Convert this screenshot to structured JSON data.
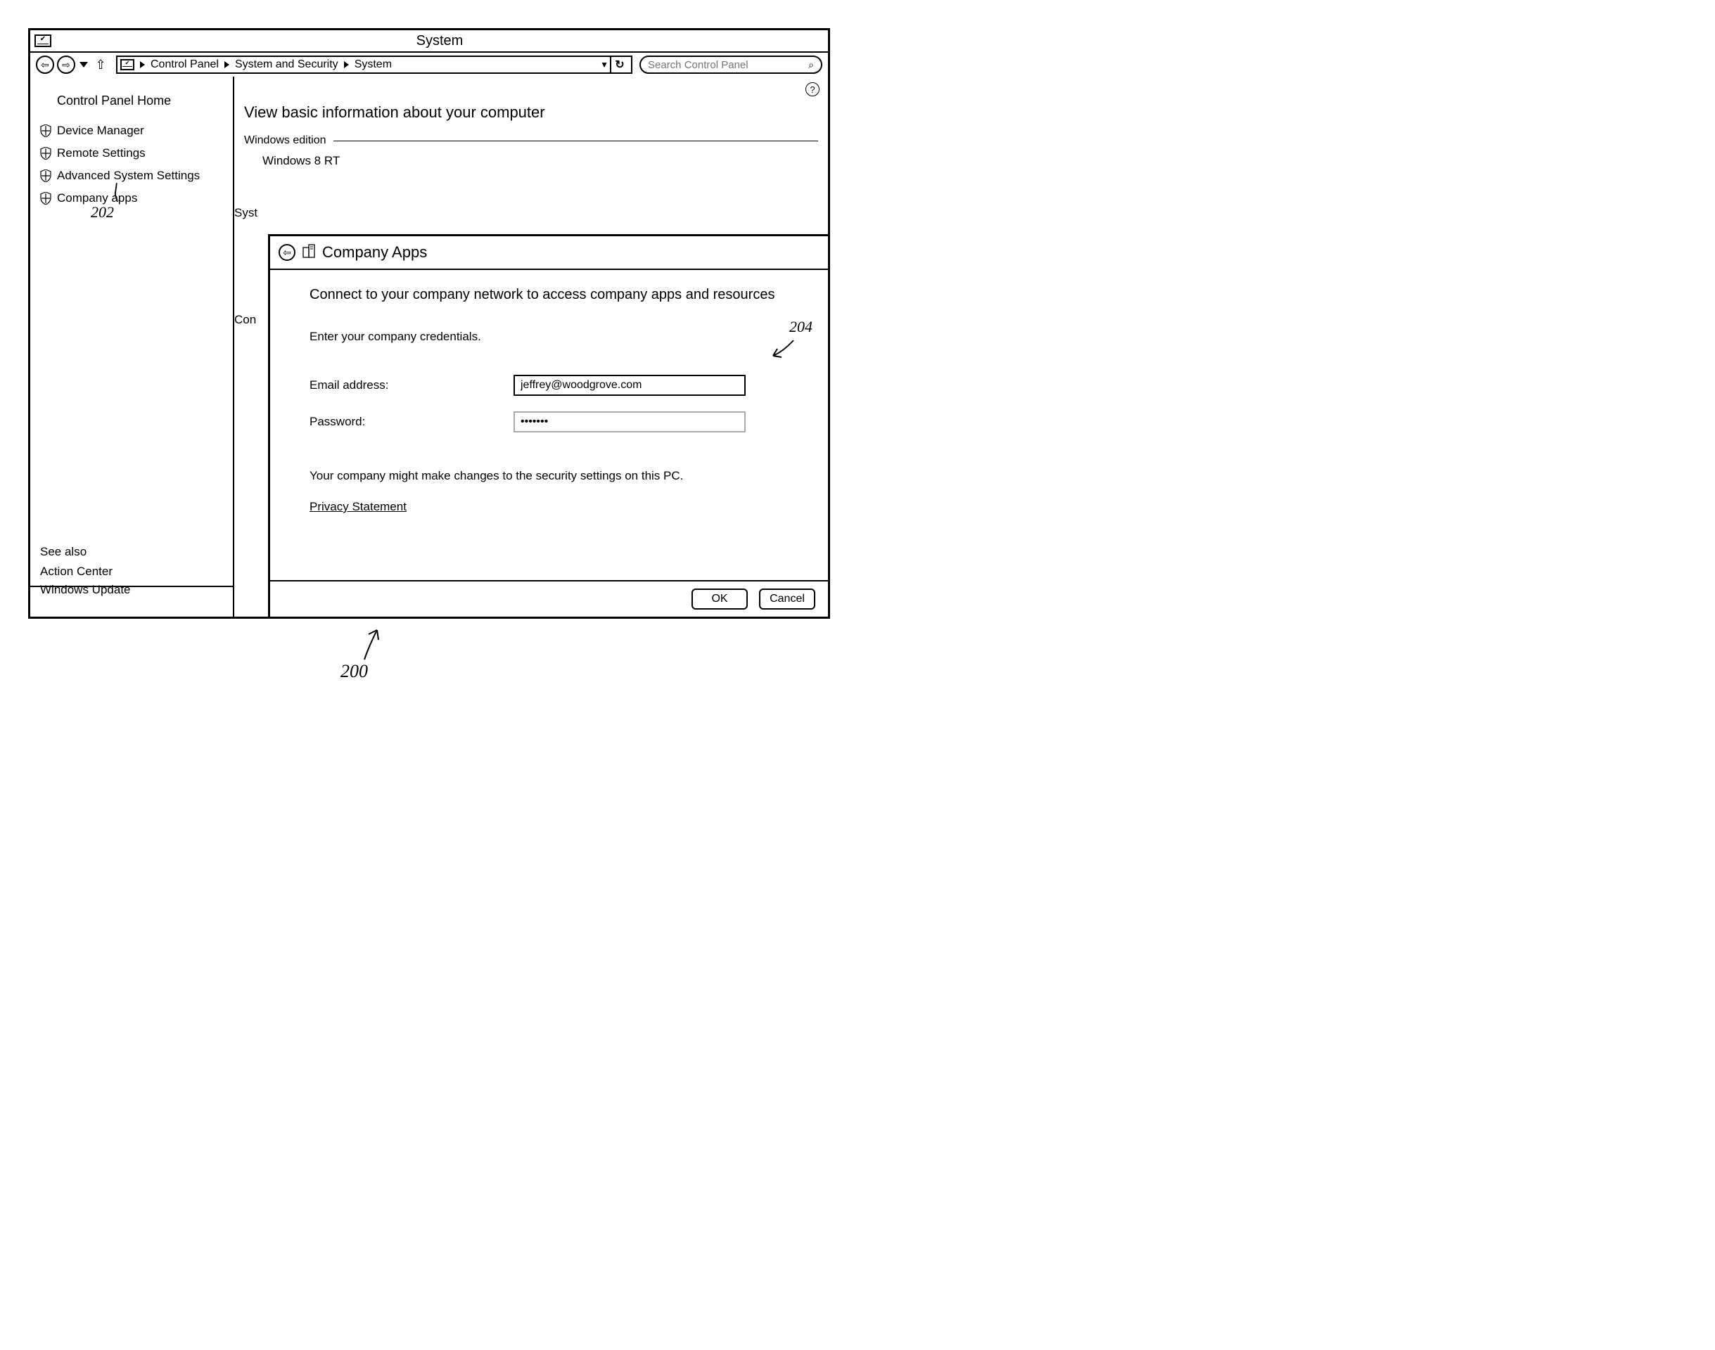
{
  "window": {
    "title": "System"
  },
  "toolbar": {
    "breadcrumb": [
      "Control Panel",
      "System and Security",
      "System"
    ],
    "search_placeholder": "Search Control Panel"
  },
  "sidebar": {
    "home": "Control Panel Home",
    "items": [
      {
        "label": "Device Manager"
      },
      {
        "label": "Remote Settings"
      },
      {
        "label": "Advanced System Settings"
      },
      {
        "label": "Company apps"
      }
    ],
    "see_also_title": "See also",
    "see_also": [
      {
        "label": "Action Center"
      },
      {
        "label": "Windows Update"
      }
    ]
  },
  "main": {
    "title": "View basic information about your computer",
    "section_windows_edition": "Windows edition",
    "edition": "Windows 8 RT",
    "partial_syst": "Syst",
    "partial_con": "Con"
  },
  "dialog": {
    "title": "Company Apps",
    "headline": "Connect to your company network to access company apps and resources",
    "sub": "Enter your company credentials.",
    "email_label": "Email address:",
    "email_value": "jeffrey@woodgrove.com",
    "password_label": "Password:",
    "password_value": "•••••••",
    "notice": "Your company might make changes to the security settings on this PC.",
    "privacy": "Privacy Statement",
    "ok": "OK",
    "cancel": "Cancel"
  },
  "annotations": {
    "a200": "200",
    "a202": "202",
    "a204": "204"
  }
}
